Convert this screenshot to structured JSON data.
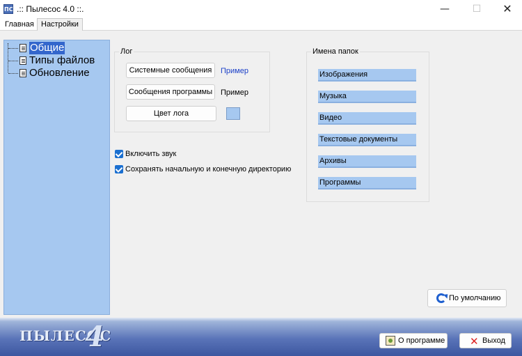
{
  "window": {
    "title": ".:: Пылесос 4.0 ::.",
    "icon_text": "ПС",
    "controls": {
      "minimize": "—",
      "maximize": "☐",
      "close": "✕"
    }
  },
  "tabs": [
    {
      "label": "Главная",
      "active": false
    },
    {
      "label": "Настройки",
      "active": true
    }
  ],
  "tree": {
    "items": [
      {
        "label": "Общие",
        "selected": true
      },
      {
        "label": "Типы файлов",
        "selected": false
      },
      {
        "label": "Обновление",
        "selected": false
      }
    ]
  },
  "log_group": {
    "title": "Лог",
    "system_messages_button": "Системные сообщения",
    "system_sample": "Пример",
    "program_messages_button": "Сообщения программы",
    "program_sample": "Пример",
    "log_color_button": "Цвет лога"
  },
  "options": {
    "enable_sound": {
      "label": "Включить звук",
      "checked": true
    },
    "save_dirs": {
      "label": "Сохранять начальную и конечную директорию",
      "checked": true
    }
  },
  "folders_group": {
    "title": "Имена папок",
    "fields": [
      "Изображения",
      "Музыка",
      "Видео",
      "Текстовые документы",
      "Архивы",
      "Программы"
    ]
  },
  "default_button": "По умолчанию",
  "bottom": {
    "logo_text": "ПЫЛЕСОС",
    "logo_number": "4",
    "about_button": "О программе",
    "exit_button": "Выход"
  },
  "colors": {
    "tree_bg": "#a6c8f0",
    "selection": "#3366cc",
    "sample_system": "#1a3fc8",
    "sample_program": "#000000",
    "log_color": "#a6c8f0",
    "bottom_bar": "#3c56a0"
  }
}
